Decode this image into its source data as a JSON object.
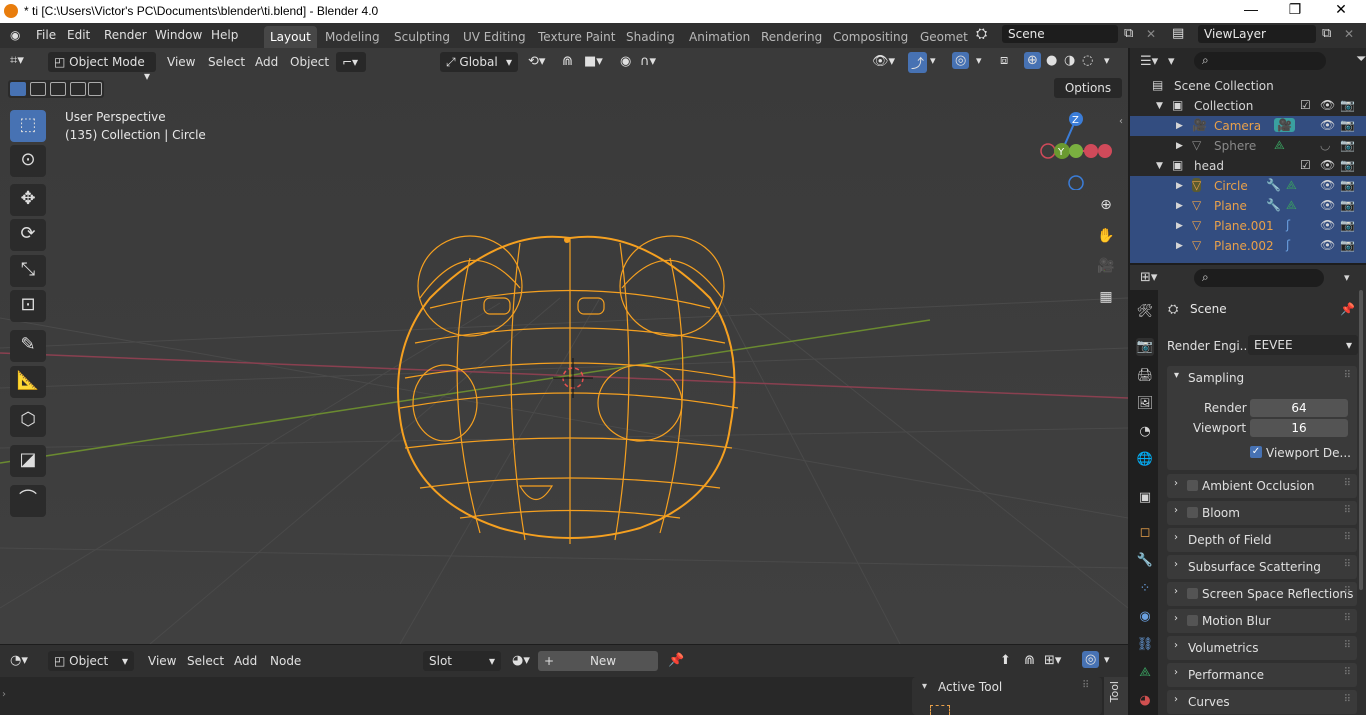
{
  "window": {
    "title": "* ti [C:\\Users\\Victor's PC\\Documents\\blender\\ti.blend] - Blender 4.0",
    "minimize": "—",
    "maximize": "❐",
    "close": "✕"
  },
  "menubar": {
    "items": [
      "File",
      "Edit",
      "Render",
      "Window",
      "Help"
    ],
    "workspaces": [
      "Layout",
      "Modeling",
      "Sculpting",
      "UV Editing",
      "Texture Paint",
      "Shading",
      "Animation",
      "Rendering",
      "Compositing",
      "Geomet"
    ],
    "active_workspace": "Layout",
    "scene": "Scene",
    "view_layer": "ViewLayer"
  },
  "viewport_header": {
    "mode": "Object Mode",
    "menus": [
      "View",
      "Select",
      "Add",
      "Object"
    ],
    "orientation": "Global",
    "options": "Options"
  },
  "viewport": {
    "perspective": "User Perspective",
    "collection_info": "(135) Collection | Circle",
    "gizmo": {
      "z": "Z",
      "y": "Y",
      "x": "X"
    }
  },
  "bottom_editor": {
    "mode": "Object",
    "menus": [
      "View",
      "Select",
      "Add",
      "Node"
    ],
    "slot": "Slot",
    "new": "New",
    "active_tool": "Active Tool",
    "tool_tab": "Tool"
  },
  "outliner": {
    "rows": [
      {
        "name": "Scene Collection",
        "style": "normal"
      },
      {
        "name": "Collection",
        "style": "normal"
      },
      {
        "name": "Camera",
        "style": "orange"
      },
      {
        "name": "Sphere",
        "style": "dim"
      },
      {
        "name": "head",
        "style": "normal"
      },
      {
        "name": "Circle",
        "style": "orange"
      },
      {
        "name": "Plane",
        "style": "orange"
      },
      {
        "name": "Plane.001",
        "style": "orange"
      },
      {
        "name": "Plane.002",
        "style": "orange"
      }
    ]
  },
  "properties": {
    "context": "Scene",
    "render_engine_label": "Render Engi...",
    "render_engine": "EEVEE",
    "sampling": {
      "title": "Sampling",
      "render_label": "Render",
      "render_value": "64",
      "viewport_label": "Viewport",
      "viewport_value": "16",
      "viewport_denoise": "Viewport De..."
    },
    "panels": [
      "Ambient Occlusion",
      "Bloom",
      "Depth of Field",
      "Subsurface Scattering",
      "Screen Space Reflections",
      "Motion Blur",
      "Volumetrics",
      "Performance",
      "Curves"
    ]
  },
  "colors": {
    "accent": "#4772b3",
    "selected_object": "#f5a020",
    "outliner_selection": "#334d80"
  }
}
